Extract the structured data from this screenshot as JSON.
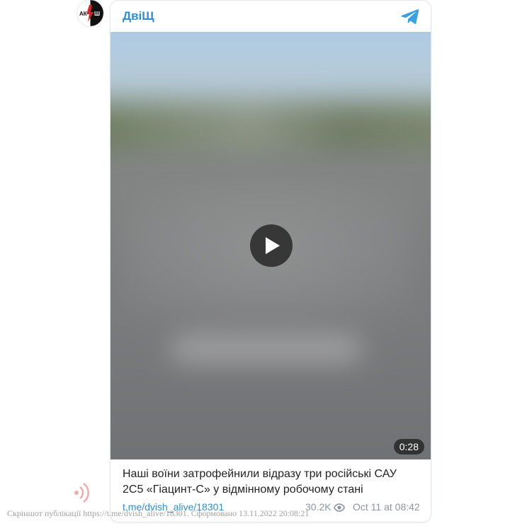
{
  "channel": {
    "name": "ДвіЩ",
    "avatar_text": "АКШ"
  },
  "video": {
    "duration": "0:28"
  },
  "post": {
    "caption": "Наші воїни затрофейнили відразу три російські САУ 2С5 «Гіацинт-С» у відмінному робочому стані",
    "link": "t.me/dvish_alive/18301",
    "views": "30.2K",
    "date": "Oct 11 at 08:42"
  },
  "watermark": {
    "text": "Скріншот публікації https://t.me/dvish_alive/18301. Сформовано 13.11.2022 20:08:21"
  },
  "icons": {
    "telegram": "telegram-icon",
    "play": "play-icon",
    "eye": "eye-icon",
    "watermark_logo": "radio-waves-icon"
  },
  "colors": {
    "accent": "#2f8fd0",
    "telegram_blue": "#3aa0e0",
    "muted_text": "#8a96a3",
    "avatar_red": "#d8262b"
  }
}
